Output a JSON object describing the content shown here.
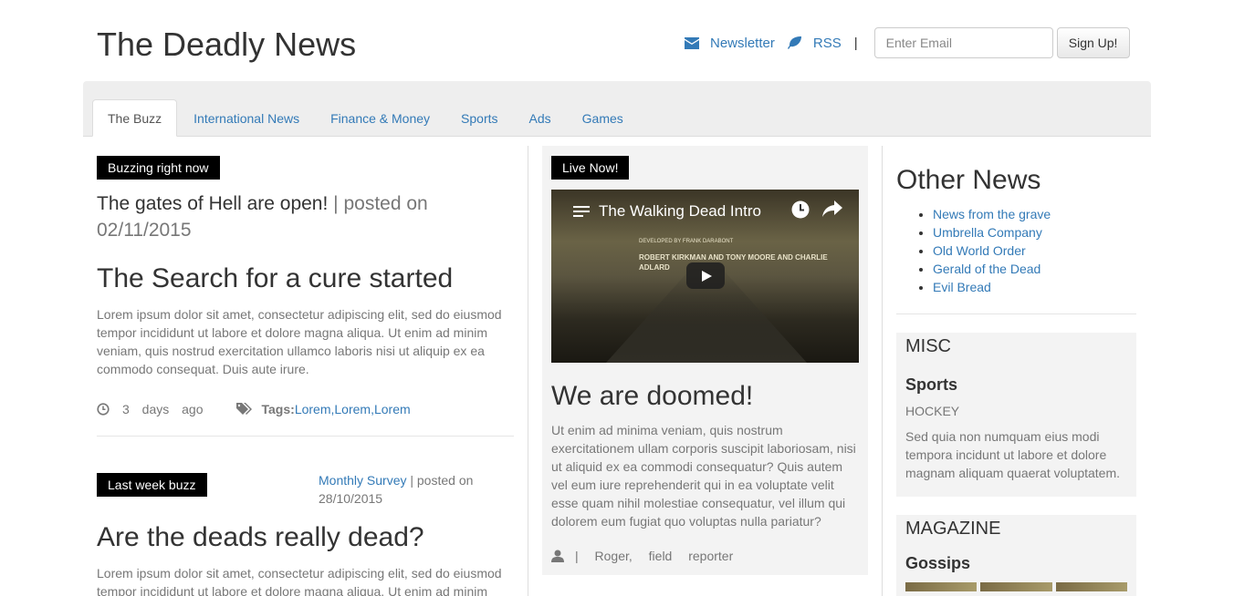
{
  "header": {
    "site_title": "The Deadly News",
    "newsletter_label": "Newsletter",
    "rss_label": "RSS",
    "separator": "|",
    "email_placeholder": "Enter Email",
    "signup_label": "Sign Up!"
  },
  "nav": {
    "tabs": [
      {
        "label": "The Buzz",
        "active": true
      },
      {
        "label": "International News"
      },
      {
        "label": "Finance & Money"
      },
      {
        "label": "Sports"
      },
      {
        "label": "Ads"
      },
      {
        "label": "Games"
      }
    ]
  },
  "left": {
    "badge": "Buzzing right now",
    "headline": "The gates of Hell are open!",
    "posted_on": "| posted on 02/11/2015",
    "article_title": "The Search for a cure started",
    "article_body": "Lorem ipsum dolor sit amet, consectetur adipiscing elit, sed do eiusmod tempor incididunt ut labore et dolore magna aliqua. Ut enim ad minim veniam, quis nostrud exercitation ullamco laboris nisi ut aliquip ex ea commodo consequat. Duis aute irure.",
    "time_ago": "3 days ago",
    "tags_label": "Tags:",
    "tags": [
      "Lorem",
      "Lorem",
      "Lorem"
    ],
    "badge2": "Last week buzz",
    "survey_link": "Monthly Survey",
    "survey_posted": " | posted on 28/10/2015",
    "article2_title": "Are the deads really dead?",
    "article2_body": "Lorem ipsum dolor sit amet, consectetur adipiscing elit, sed do eiusmod tempor incididunt ut labore et dolore magna aliqua. Ut enim ad minim"
  },
  "middle": {
    "badge": "Live Now!",
    "video_title": "The Walking Dead Intro",
    "video_credit_1": "DEVELOPED BY FRANK DARABONT",
    "video_credit_2": "ROBERT KIRKMAN AND TONY MOORE AND CHARLIE ADLARD",
    "title": "We are doomed!",
    "body": "Ut enim ad minima veniam, quis nostrum exercitationem ullam corporis suscipit laboriosam, nisi ut aliquid ex ea commodi consequatur? Quis autem vel eum iure reprehenderit qui in ea voluptate velit esse quam nihil molestiae consequatur, vel illum qui dolorem eum fugiat quo voluptas nulla pariatur?",
    "reporter": "| Roger, field reporter"
  },
  "right": {
    "other_title": "Other News",
    "other_items": [
      "News from the grave",
      "Umbrella Company",
      "Old World Order",
      "Gerald of the Dead",
      "Evil Bread"
    ],
    "misc_title": "MISC",
    "misc_sub": "Sports",
    "misc_small": "HOCKEY",
    "misc_text": "Sed quia non numquam eius modi tempora incidunt ut labore et dolore magnam aliquam quaerat voluptatem.",
    "magazine_title": "MAGAZINE",
    "magazine_sub": "Gossips"
  }
}
